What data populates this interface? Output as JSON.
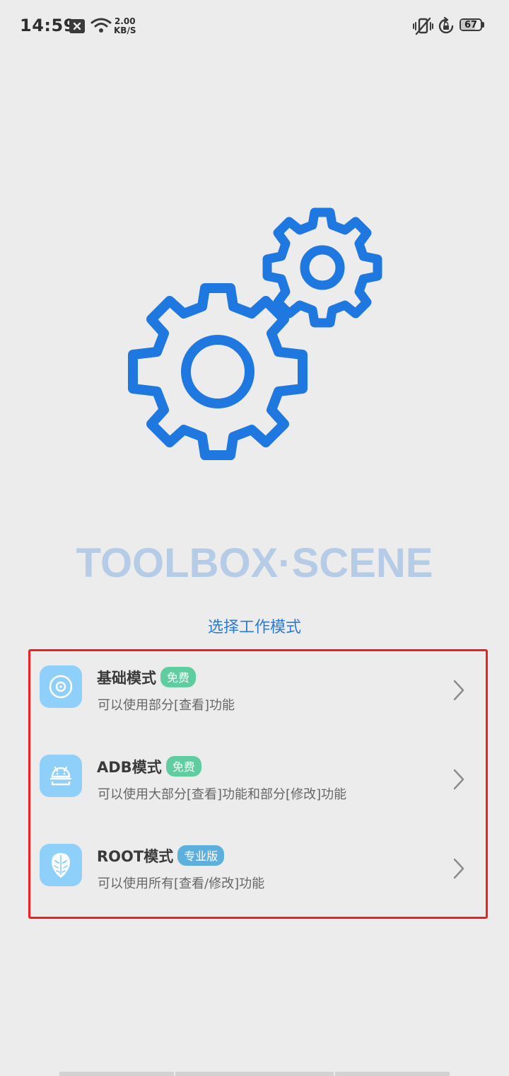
{
  "status_bar": {
    "time": "14:59",
    "net_speed_value": "2.00",
    "net_speed_unit": "KB/S",
    "battery_level": "67",
    "icons": [
      "notification-close-icon",
      "wifi-icon",
      "vibrate-off-icon",
      "rotation-lock-icon",
      "battery-icon"
    ]
  },
  "hero": {
    "icon": "gears-icon",
    "brand": "TOOLBOX·SCENE",
    "subtitle": "选择工作模式"
  },
  "modes": [
    {
      "title": "基础模式",
      "badge": "免费",
      "description": "可以使用部分[查看]功能",
      "icon": "disc-icon"
    },
    {
      "title": "ADB模式",
      "badge": "免费",
      "description": "可以使用大部分[查看]功能和部分[修改]功能",
      "icon": "android-icon"
    },
    {
      "title": "ROOT模式",
      "badge": "专业版",
      "description": "可以使用所有[查看/修改]功能",
      "icon": "mask-icon"
    }
  ],
  "colors": {
    "background": "#ececec",
    "accent_blue": "#1f78e0",
    "brand_text": "#b5cbe6",
    "subtitle": "#2d7cd0",
    "badge_free": "#5fcd9f",
    "badge_pro": "#5db0dd",
    "icon_bg": "#8fd0fb",
    "highlight_border": "#f02020"
  }
}
